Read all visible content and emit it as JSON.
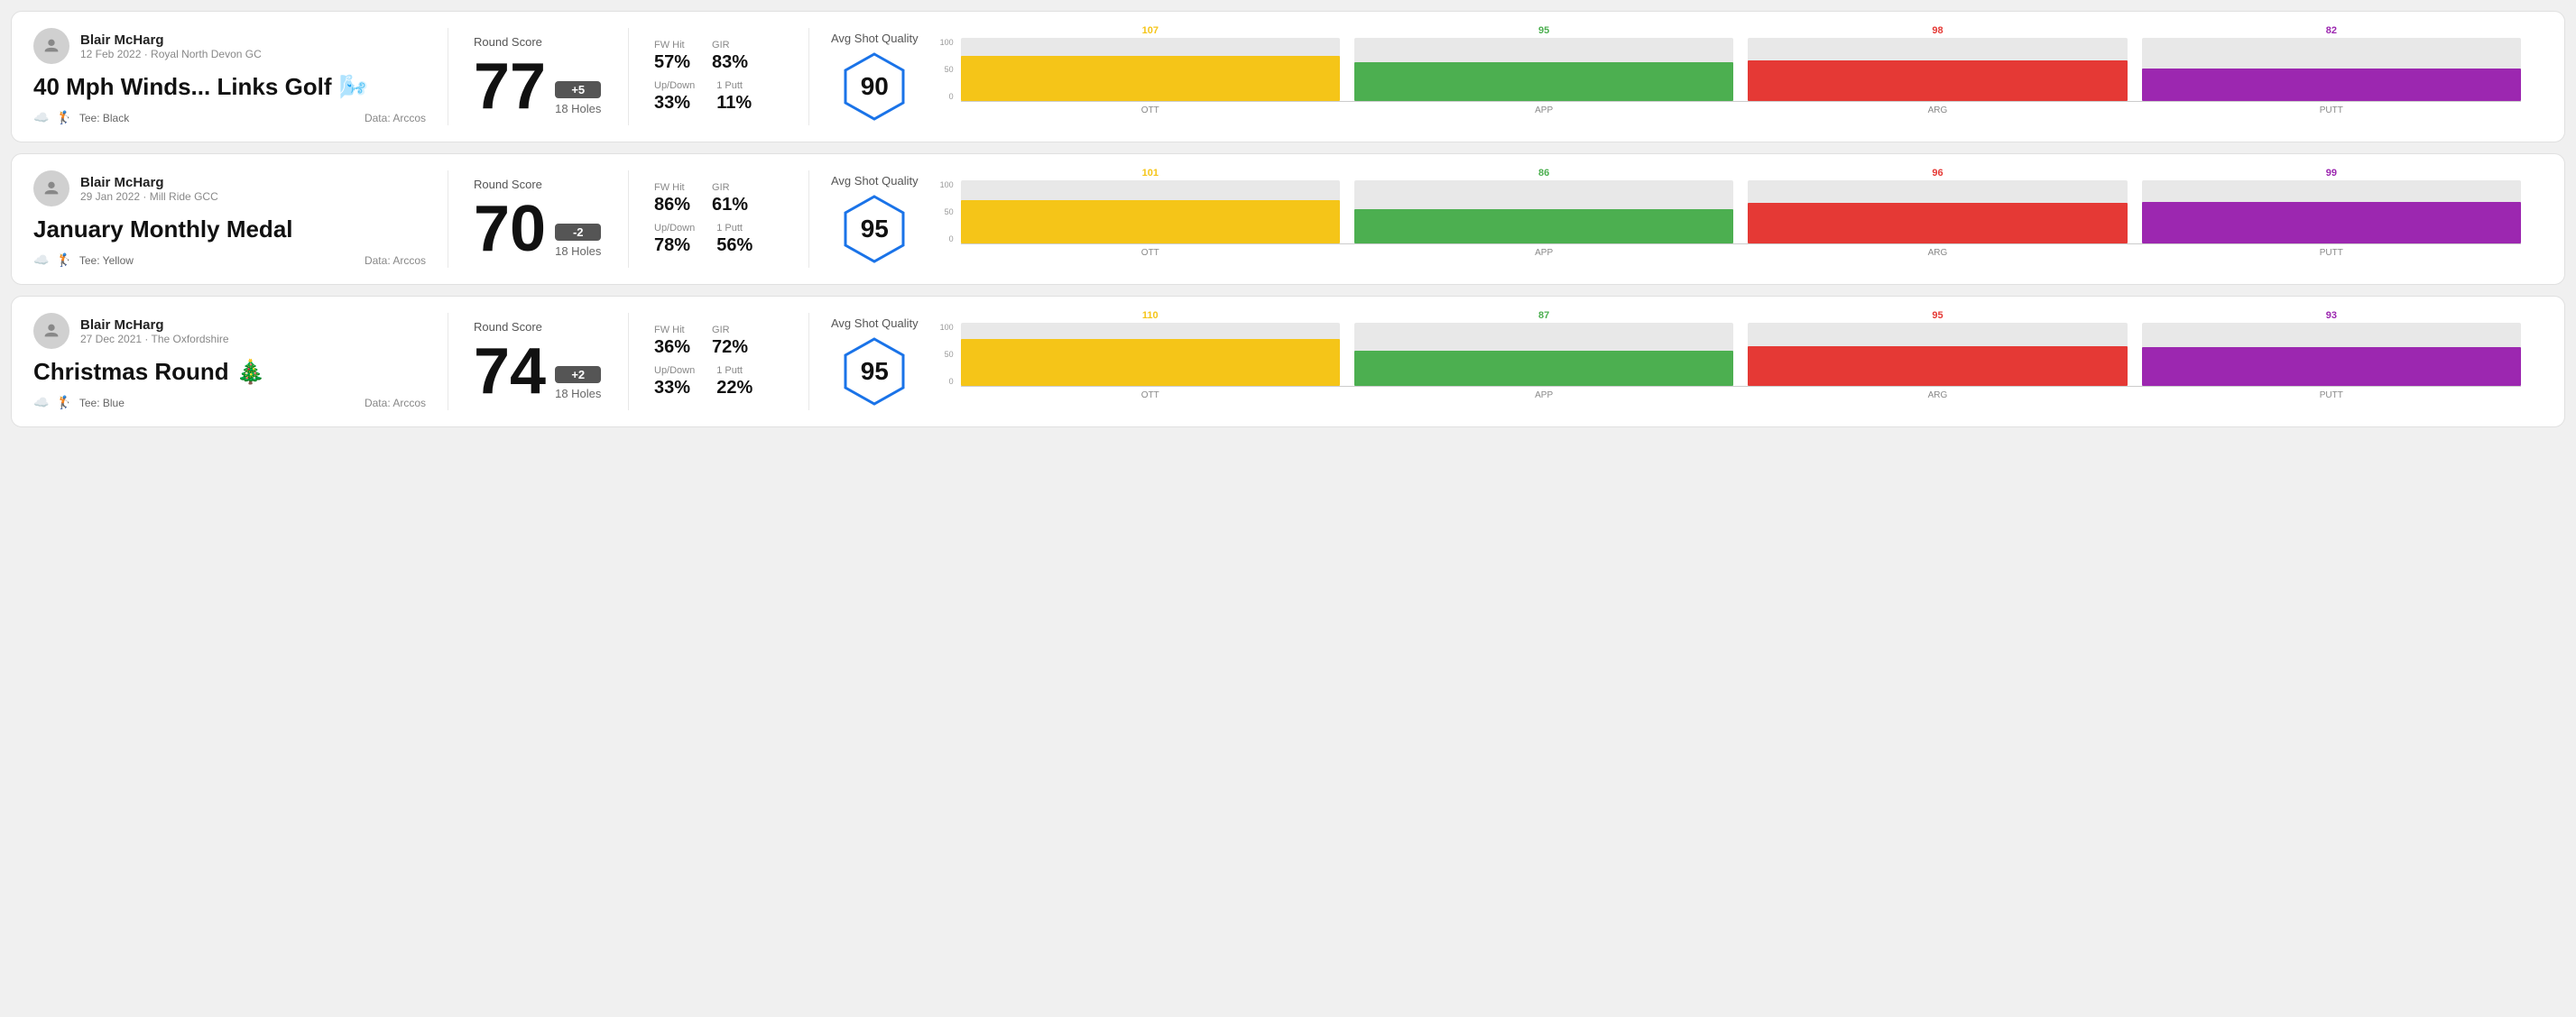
{
  "rounds": [
    {
      "id": "round-1",
      "userName": "Blair McHarg",
      "date": "12 Feb 2022 · Royal North Devon GC",
      "title": "40 Mph Winds... Links Golf",
      "titleEmoji": "🌬️",
      "tee": "Black",
      "dataSource": "Data: Arccos",
      "score": "77",
      "scoreBadge": "+5",
      "badgeType": "positive",
      "holes": "18 Holes",
      "fwHit": "57%",
      "gir": "83%",
      "upDown": "33%",
      "onePutt": "11%",
      "avgShotQuality": "90",
      "chart": {
        "bars": [
          {
            "label": "OTT",
            "value": 107,
            "color": "#f5c518",
            "heightPct": 72
          },
          {
            "label": "APP",
            "value": 95,
            "color": "#4caf50",
            "heightPct": 62
          },
          {
            "label": "ARG",
            "value": 98,
            "color": "#e53935",
            "heightPct": 65
          },
          {
            "label": "PUTT",
            "value": 82,
            "color": "#9c27b0",
            "heightPct": 52
          }
        ],
        "yLabels": [
          "100",
          "50",
          "0"
        ]
      }
    },
    {
      "id": "round-2",
      "userName": "Blair McHarg",
      "date": "29 Jan 2022 · Mill Ride GCC",
      "title": "January Monthly Medal",
      "titleEmoji": "",
      "tee": "Yellow",
      "dataSource": "Data: Arccos",
      "score": "70",
      "scoreBadge": "-2",
      "badgeType": "negative",
      "holes": "18 Holes",
      "fwHit": "86%",
      "gir": "61%",
      "upDown": "78%",
      "onePutt": "56%",
      "avgShotQuality": "95",
      "chart": {
        "bars": [
          {
            "label": "OTT",
            "value": 101,
            "color": "#f5c518",
            "heightPct": 68
          },
          {
            "label": "APP",
            "value": 86,
            "color": "#4caf50",
            "heightPct": 55
          },
          {
            "label": "ARG",
            "value": 96,
            "color": "#e53935",
            "heightPct": 64
          },
          {
            "label": "PUTT",
            "value": 99,
            "color": "#9c27b0",
            "heightPct": 66
          }
        ],
        "yLabels": [
          "100",
          "50",
          "0"
        ]
      }
    },
    {
      "id": "round-3",
      "userName": "Blair McHarg",
      "date": "27 Dec 2021 · The Oxfordshire",
      "title": "Christmas Round",
      "titleEmoji": "🎄",
      "tee": "Blue",
      "dataSource": "Data: Arccos",
      "score": "74",
      "scoreBadge": "+2",
      "badgeType": "positive",
      "holes": "18 Holes",
      "fwHit": "36%",
      "gir": "72%",
      "upDown": "33%",
      "onePutt": "22%",
      "avgShotQuality": "95",
      "chart": {
        "bars": [
          {
            "label": "OTT",
            "value": 110,
            "color": "#f5c518",
            "heightPct": 74
          },
          {
            "label": "APP",
            "value": 87,
            "color": "#4caf50",
            "heightPct": 56
          },
          {
            "label": "ARG",
            "value": 95,
            "color": "#e53935",
            "heightPct": 63
          },
          {
            "label": "PUTT",
            "value": 93,
            "color": "#9c27b0",
            "heightPct": 62
          }
        ],
        "yLabels": [
          "100",
          "50",
          "0"
        ]
      }
    }
  ],
  "labels": {
    "roundScore": "Round Score",
    "fwHit": "FW Hit",
    "gir": "GIR",
    "upDown": "Up/Down",
    "onePutt": "1 Putt",
    "avgShotQuality": "Avg Shot Quality",
    "data": "Data: Arccos",
    "teePrefix": "Tee:"
  }
}
